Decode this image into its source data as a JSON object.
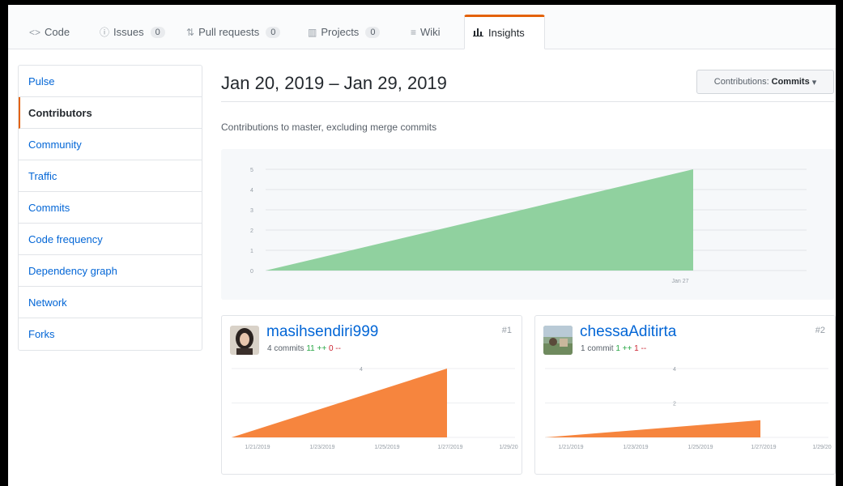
{
  "tabs": [
    {
      "icon": "<>",
      "label": "Code",
      "count": null
    },
    {
      "icon": "ⓘ",
      "label": "Issues",
      "count": "0"
    },
    {
      "icon": "⇅",
      "label": "Pull requests",
      "count": "0"
    },
    {
      "icon": "▥",
      "label": "Projects",
      "count": "0"
    },
    {
      "icon": "≡",
      "label": "Wiki",
      "count": null
    },
    {
      "icon": "📊",
      "label": "Insights",
      "count": null
    }
  ],
  "sidebar": {
    "items": [
      {
        "label": "Pulse"
      },
      {
        "label": "Contributors"
      },
      {
        "label": "Community"
      },
      {
        "label": "Traffic"
      },
      {
        "label": "Commits"
      },
      {
        "label": "Code frequency"
      },
      {
        "label": "Dependency graph"
      },
      {
        "label": "Network"
      },
      {
        "label": "Forks"
      }
    ],
    "selected": "Contributors"
  },
  "main": {
    "date_range": "Jan 20, 2019 – Jan 29, 2019",
    "contrib_button": {
      "prefix": "Contributions:",
      "value": "Commits"
    },
    "subtitle": "Contributions to master, excluding merge commits"
  },
  "contributors": [
    {
      "username": "masihsendiri999",
      "rank": "#1",
      "commits": "4 commits",
      "additions": "11 ++",
      "deletions": "0 --"
    },
    {
      "username": "chessaAditirta",
      "rank": "#2",
      "commits": "1 commit",
      "additions": "1 ++",
      "deletions": "1 --"
    }
  ],
  "colors": {
    "accent": "#e36209",
    "main_area": "#90d19f",
    "contrib_area": "#f6853e",
    "link": "#0366d6"
  },
  "chart_data": [
    {
      "type": "area",
      "title": "",
      "x": [
        "Jan 20",
        "Jan 27"
      ],
      "y": [
        0,
        5
      ],
      "ylim": [
        0,
        5
      ],
      "yticks": [
        "0",
        "1",
        "2",
        "3",
        "4",
        "5"
      ],
      "xticks": [
        "Jan 27"
      ],
      "color": "#90d19f"
    },
    {
      "type": "area",
      "title": "masihsendiri999",
      "x": [
        "1/20/2019",
        "1/27/2019"
      ],
      "y": [
        0,
        4
      ],
      "ylim": [
        0,
        4
      ],
      "yticks": [
        "4"
      ],
      "xticks": [
        "1/21/2019",
        "1/23/2019",
        "1/25/2019",
        "1/27/2019",
        "1/29/20"
      ],
      "color": "#f6853e"
    },
    {
      "type": "area",
      "title": "chessaAditirta",
      "x": [
        "1/20/2019",
        "1/27/2019"
      ],
      "y": [
        0,
        1
      ],
      "ylim": [
        0,
        4
      ],
      "yticks": [
        "4",
        "2"
      ],
      "xticks": [
        "1/21/2019",
        "1/23/2019",
        "1/25/2019",
        "1/27/2019",
        "1/29/20"
      ],
      "color": "#f6853e"
    }
  ]
}
